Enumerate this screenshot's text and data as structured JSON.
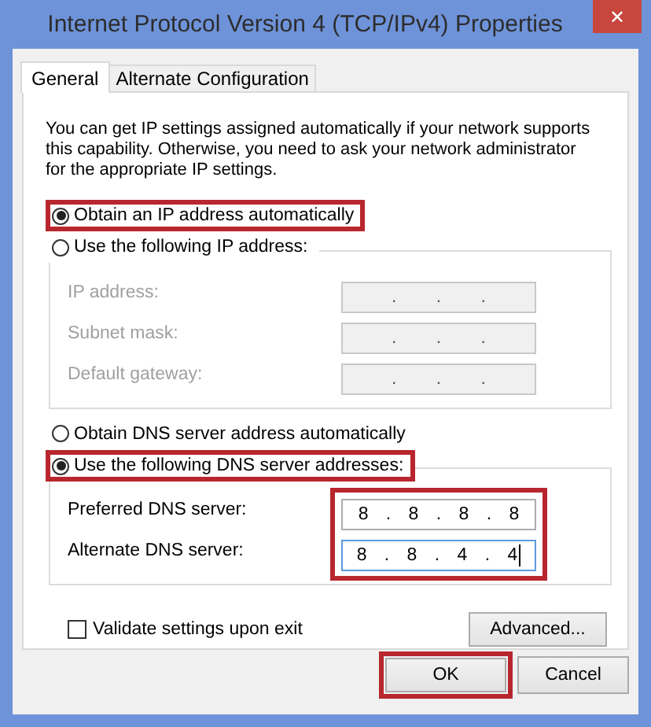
{
  "window": {
    "title": "Internet Protocol Version 4 (TCP/IPv4) Properties",
    "close": "✕"
  },
  "tabs": [
    {
      "label": "General",
      "selected": true
    },
    {
      "label": "Alternate Configuration",
      "selected": false
    }
  ],
  "intro": "You can get IP settings assigned automatically if your network supports this capability. Otherwise, you need to ask your network administrator for the appropriate IP settings.",
  "ip_options": [
    {
      "label": "Obtain an IP address automatically",
      "selected": true,
      "highlighted": true
    },
    {
      "label": "Use the following IP address:",
      "selected": false,
      "highlighted": false
    }
  ],
  "ip_fields": {
    "highlighted": false,
    "rows": [
      {
        "label": "IP address:",
        "value": ". . .",
        "disabled": true,
        "focused": false
      },
      {
        "label": "Subnet mask:",
        "value": ". . .",
        "disabled": true,
        "focused": false
      },
      {
        "label": "Default gateway:",
        "value": ". . .",
        "disabled": true,
        "focused": false
      }
    ]
  },
  "dns_options": [
    {
      "label": "Obtain DNS server address automatically",
      "selected": false,
      "highlighted": false
    },
    {
      "label": "Use the following DNS server addresses:",
      "selected": true,
      "highlighted": true
    }
  ],
  "dns_fields": {
    "highlighted": true,
    "rows": [
      {
        "label": "Preferred DNS server:",
        "value": "8 . 8 . 8 . 8",
        "disabled": false,
        "focused": false
      },
      {
        "label": "Alternate DNS server:",
        "value": "8 . 8 . 4 . 4",
        "disabled": false,
        "focused": true
      }
    ]
  },
  "validate": {
    "label": "Validate settings upon exit",
    "checked": false
  },
  "advanced_button": "Advanced...",
  "buttons": [
    {
      "label": "OK",
      "highlighted": true
    },
    {
      "label": "Cancel",
      "highlighted": false
    }
  ]
}
